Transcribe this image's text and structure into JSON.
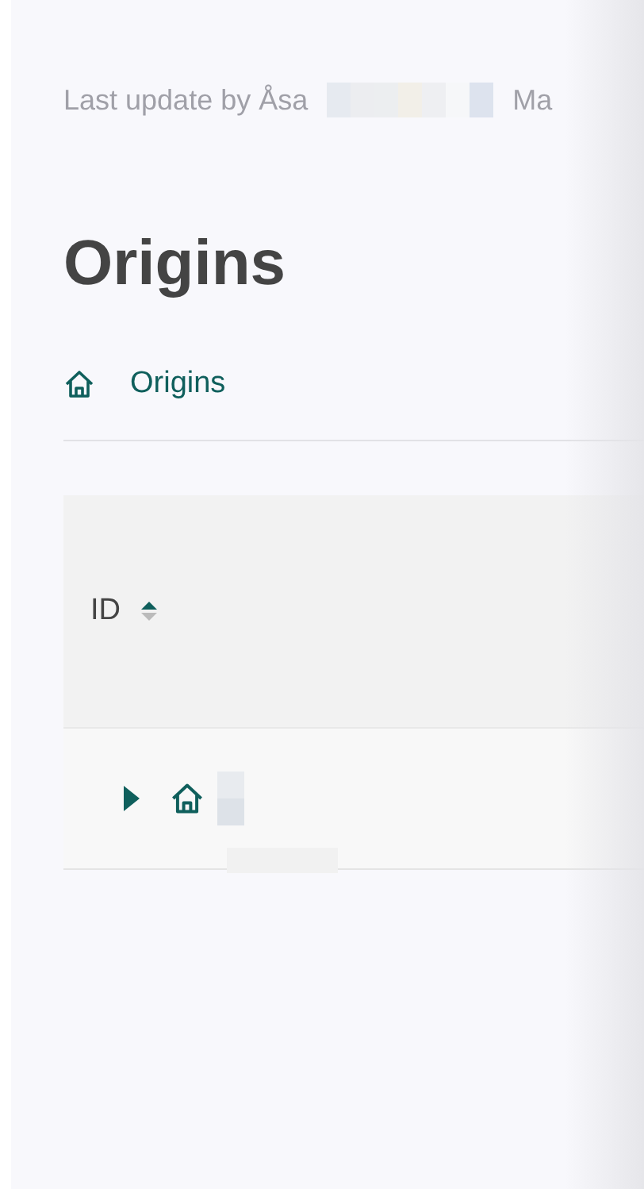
{
  "last_update": {
    "prefix": "Last update by Åsa",
    "suffix": "Ma"
  },
  "title": "Origins",
  "breadcrumb": [
    {
      "label": "Origins"
    }
  ],
  "table": {
    "columns": [
      {
        "label": "ID",
        "sort_ascending": true
      }
    ],
    "rows": [
      {
        "expanded": false
      }
    ]
  }
}
